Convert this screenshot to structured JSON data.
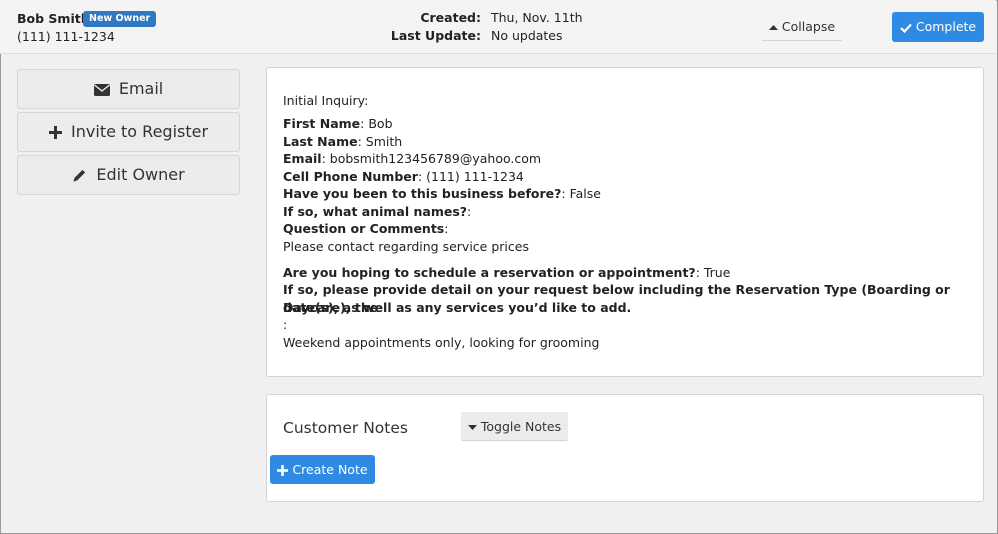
{
  "header": {
    "owner_name": "Bob Smith",
    "badge": "New Owner",
    "phone": "(111) 111-1234",
    "created_label": "Created:",
    "created_value": "Thu, Nov. 11th",
    "updated_label": "Last Update:",
    "updated_value": "No updates",
    "collapse_label": "Collapse",
    "complete_label": "Complete"
  },
  "sidebar": {
    "email_label": "Email",
    "invite_label": "Invite to Register",
    "edit_label": "Edit Owner"
  },
  "inquiry": {
    "title": "Initial Inquiry:",
    "first_name_label": "First Name",
    "first_name": ": Bob",
    "last_name_label": "Last Name",
    "last_name": ": Smith",
    "email_label": "Email",
    "email": ": bobsmith123456789@yahoo.com",
    "cell_label": "Cell Phone Number",
    "cell": ": (111) 111-1234",
    "visited_label": "Have you been to this business before?",
    "visited": ": False",
    "animals_label": "If so, what animal names?",
    "animals": ":",
    "comments_label": "Question or Comments",
    "comments_colon": ":",
    "comments": "Please contact regarding service prices",
    "reserve_label": "Are you hoping to schedule a reservation or appointment?",
    "reserve": ": True",
    "detail_label_1": "If so, please provide detail on your request below including the Reservation Type (Boarding or Daycare), the",
    "detail_label_2": "date(s), as well as any services you’d like to add.",
    "detail_colon": ":",
    "detail": "Weekend appointments only, looking for grooming"
  },
  "notes": {
    "title": "Customer Notes",
    "toggle_label": "Toggle Notes",
    "create_label": "Create Note"
  },
  "colors": {
    "primary": "#2f8ae3",
    "badge": "#2f78c4"
  }
}
